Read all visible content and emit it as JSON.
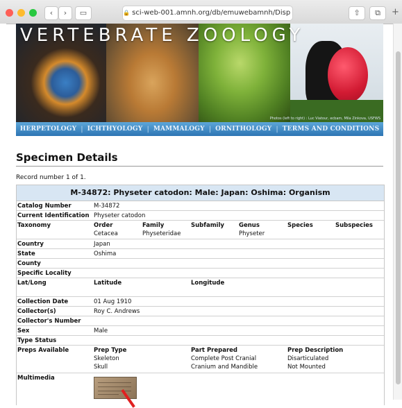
{
  "browser": {
    "url": "sci-web-001.amnh.org/db/emuwebamnh/Disp",
    "back_glyph": "‹",
    "forward_glyph": "›",
    "sidebar_glyph": "▭",
    "share_glyph": "⇧",
    "tabs_glyph": "⧉",
    "newtab_glyph": "+",
    "reload_glyph": "↻",
    "lock_glyph": "🔒",
    "colors": {
      "close": "#fe5f57",
      "minimize": "#febb2e",
      "zoom": "#28c840"
    }
  },
  "banner": {
    "title": "VERTEBRATE ZOOLOGY",
    "credit": "Photos (left to right) : Luc Viatour, ecbam, Mila Zinkova, USFWS",
    "nav": [
      "HERPETOLOGY",
      "ICHTHYOLOGY",
      "MAMMALOGY",
      "ORNITHOLOGY",
      "TERMS AND CONDITIONS"
    ]
  },
  "page": {
    "heading": "Specimen Details",
    "record_text": "Record number 1 of 1."
  },
  "specimen": {
    "title": "M-34872: Physeter catodon: Male: Japan: Oshima: Organism",
    "labels": {
      "catalog": "Catalog Number",
      "identification": "Current Identification",
      "taxonomy": "Taxonomy",
      "country": "Country",
      "state": "State",
      "county": "County",
      "locality": "Specific Locality",
      "latlong": "Lat/Long",
      "date": "Collection Date",
      "collector": "Collector(s)",
      "collector_number": "Collector's Number",
      "sex": "Sex",
      "type_status": "Type Status",
      "preps": "Preps Available",
      "multimedia": "Multimedia"
    },
    "catalog_number": "M-34872",
    "current_identification": "Physeter catodon",
    "taxonomy_headers": [
      "Order",
      "Family",
      "Subfamily",
      "Genus",
      "Species",
      "Subspecies"
    ],
    "taxonomy_values": [
      "Cetacea",
      "Physeteridae",
      "",
      "Physeter",
      "",
      ""
    ],
    "country": "Japan",
    "state": "Oshima",
    "latlong_headers": [
      "Latitude",
      "Longitude"
    ],
    "collection_date": "01 Aug 1910",
    "collector": "Roy C. Andrews",
    "sex": "Male",
    "prep_headers": [
      "Prep Type",
      "Part Prepared",
      "Prep Description"
    ],
    "preps": [
      {
        "type": "Skeleton",
        "part": "Complete Post Cranial",
        "description": "Disarticulated"
      },
      {
        "type": "Skull",
        "part": "Cranium and Mandible",
        "description": "Not Mounted"
      }
    ]
  }
}
